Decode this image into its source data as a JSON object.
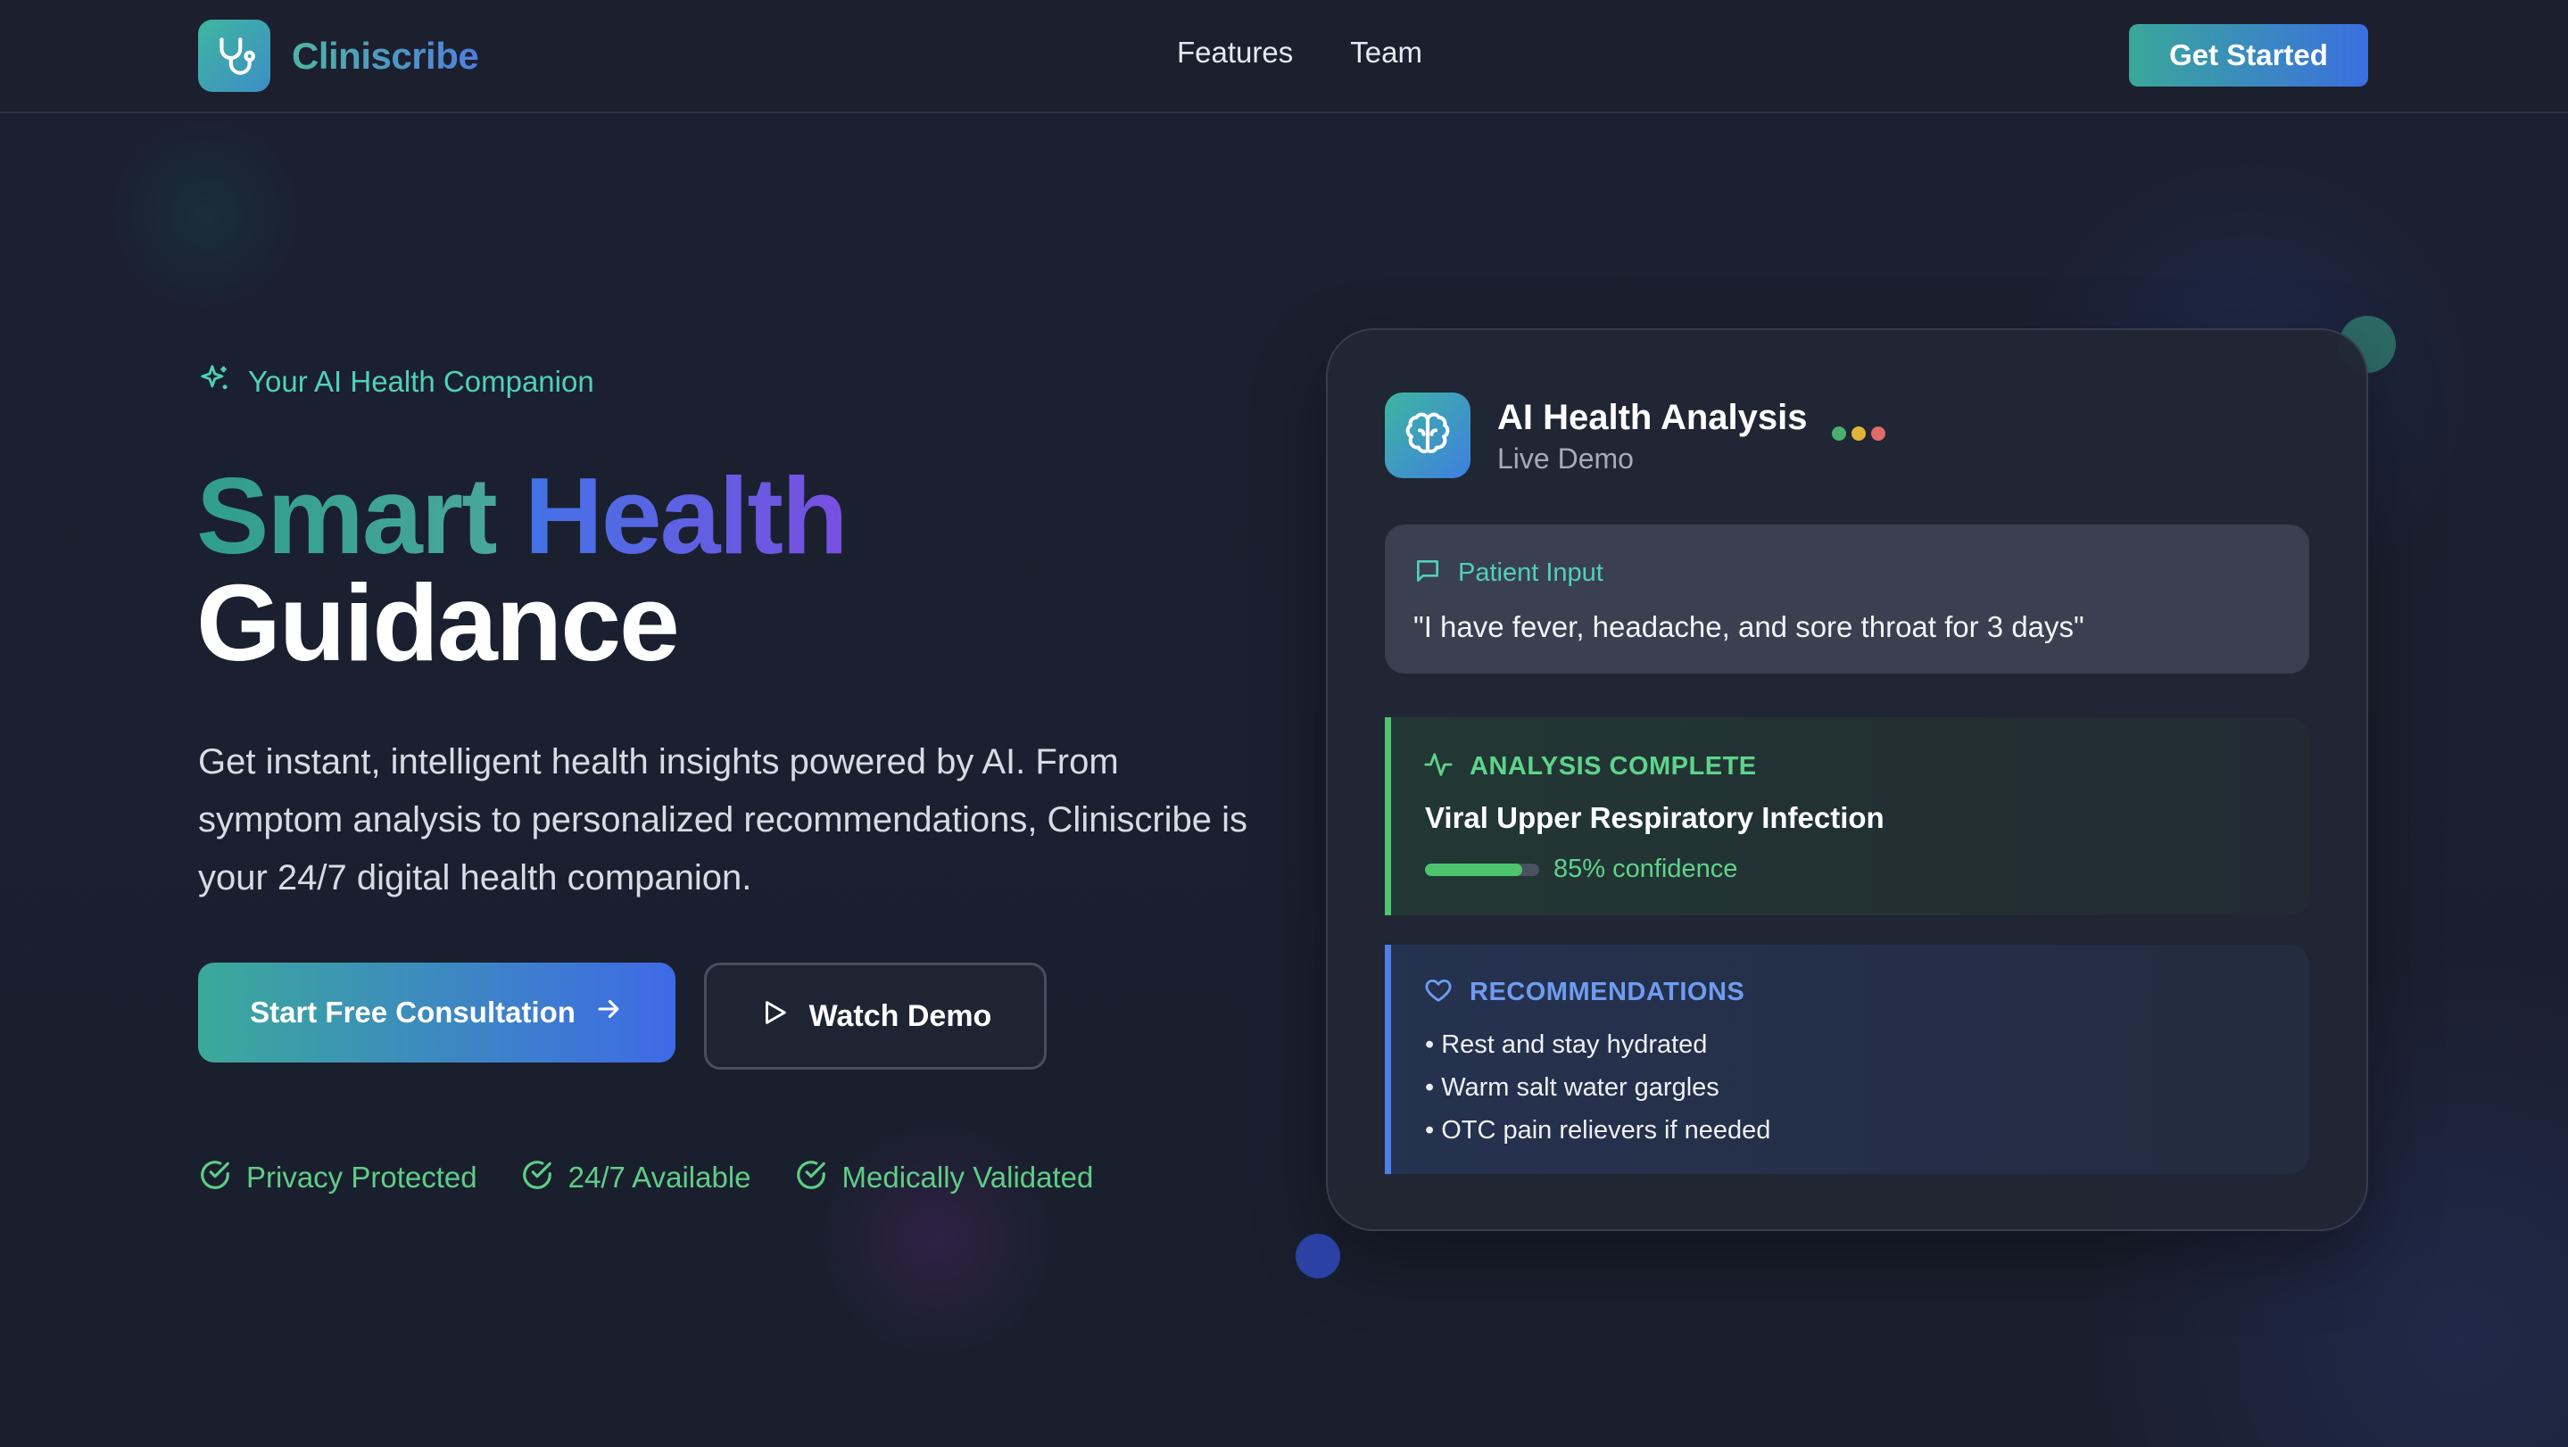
{
  "nav": {
    "brand": "Cliniscribe",
    "brand_icon": "stethoscope-icon",
    "links": [
      "Features",
      "Team"
    ],
    "cta": "Get Started"
  },
  "hero": {
    "tagline": "Your AI Health Companion",
    "tagline_icon": "sparkles-icon",
    "headline_word1": "Smart",
    "headline_word2": "Health",
    "headline_line2": "Guidance",
    "subtext": "Get instant, intelligent health insights powered by AI. From symptom analysis to personalized recommendations, Cliniscribe is your 24/7 digital health companion.",
    "primary_button": "Start Free Consultation",
    "secondary_button": "Watch Demo",
    "badges": [
      "Privacy Protected",
      "24/7 Available",
      "Medically Validated"
    ]
  },
  "demo_card": {
    "icon": "brain-icon",
    "title": "AI Health Analysis",
    "subtitle": "Live Demo",
    "status_dot_colors": [
      "#4caf6e",
      "#e0b43a",
      "#e06a6a"
    ],
    "patient_input": {
      "label": "Patient Input",
      "icon": "message-square-icon",
      "quote": "\"I have fever, headache, and sore throat for 3 days\""
    },
    "analysis": {
      "label": "ANALYSIS COMPLETE",
      "icon": "activity-icon",
      "diagnosis": "Viral Upper Respiratory Infection",
      "confidence": 0.85,
      "confidence_label": "85% confidence"
    },
    "recommendations": {
      "label": "RECOMMENDATIONS",
      "icon": "heart-icon",
      "items": [
        "• Rest and stay hydrated",
        "• Warm salt water gargles",
        "• OTC pain relievers if needed"
      ]
    }
  },
  "colors": {
    "background": "#1a1f2e",
    "teal_accent": "#4fd1b8",
    "green_accent": "#5ed48a",
    "blue_accent": "#4f7fe8"
  }
}
